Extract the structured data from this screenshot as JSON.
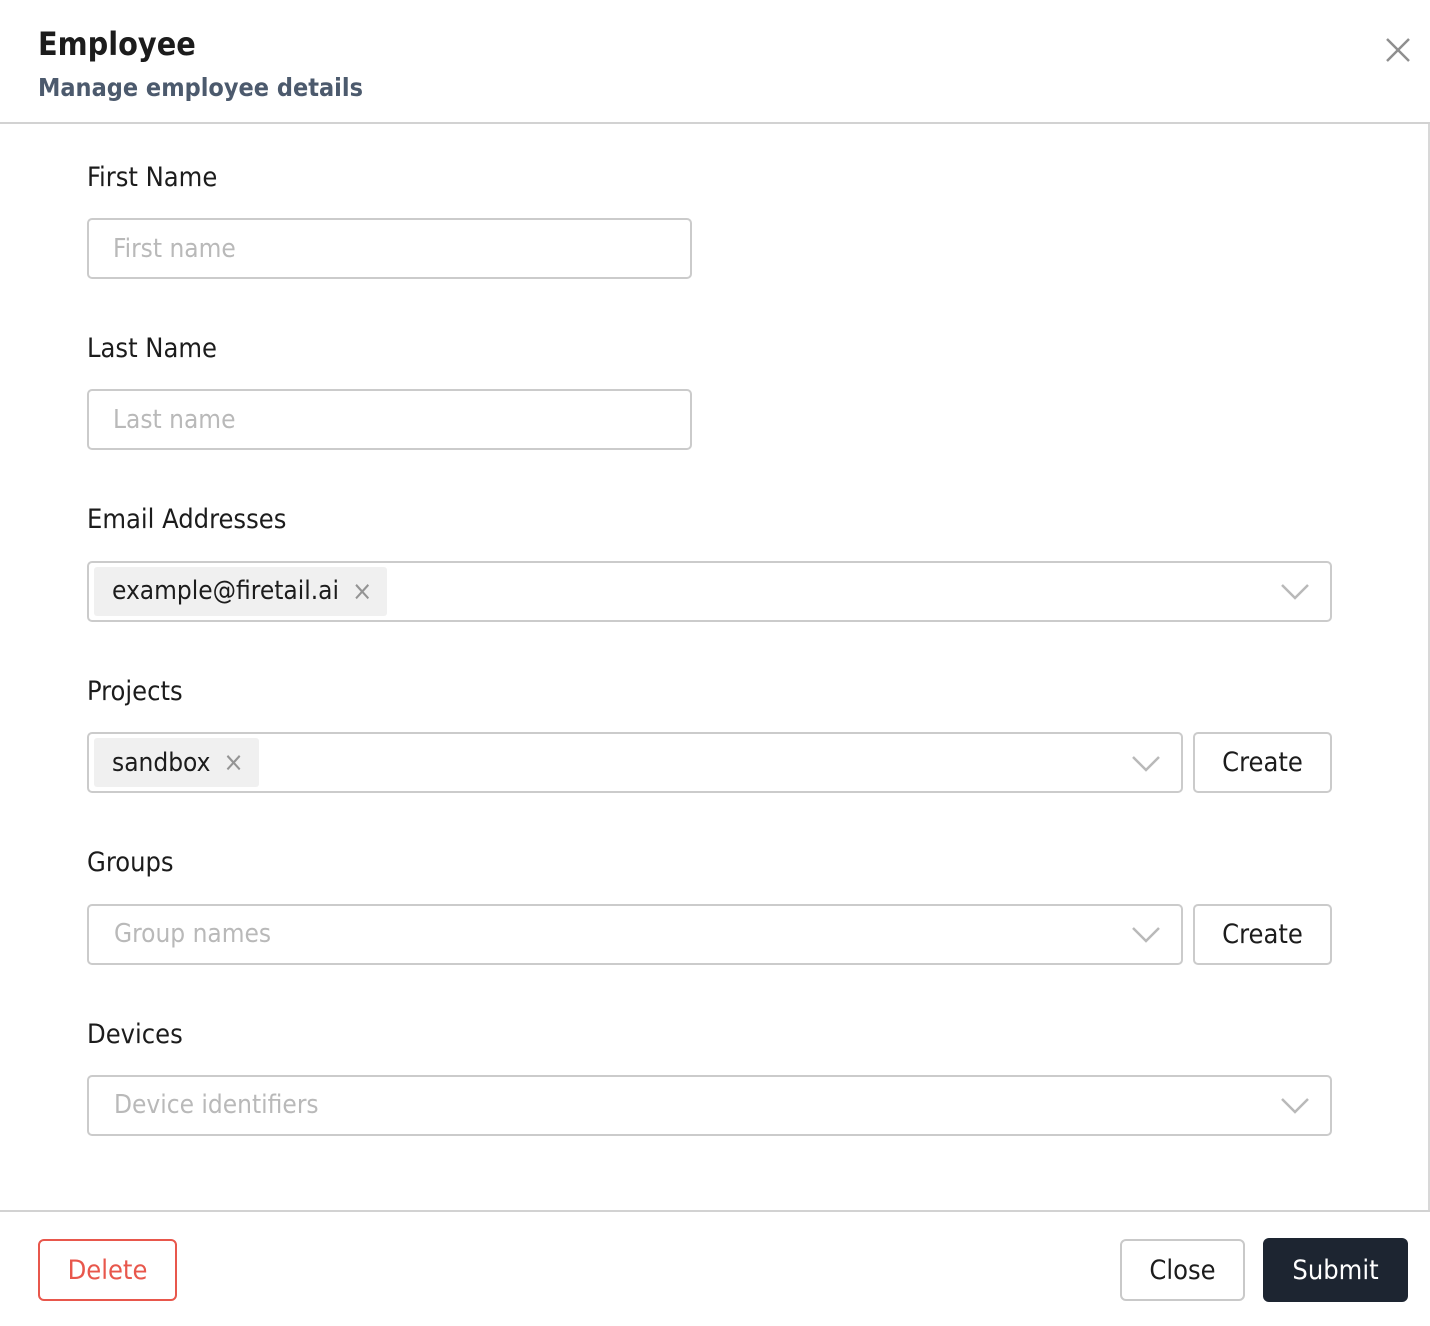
{
  "modal": {
    "title": "Employee",
    "subtitle": "Manage employee details"
  },
  "fields": {
    "first_name": {
      "label": "First Name",
      "placeholder": "First name",
      "value": ""
    },
    "last_name": {
      "label": "Last Name",
      "placeholder": "Last name",
      "value": ""
    },
    "emails": {
      "label": "Email Addresses",
      "tags": [
        "example@firetail.ai"
      ],
      "remove_glyph": "×"
    },
    "projects": {
      "label": "Projects",
      "tags": [
        "sandbox"
      ],
      "remove_glyph": "×",
      "create_label": "Create"
    },
    "groups": {
      "label": "Groups",
      "placeholder": "Group names",
      "value": "",
      "create_label": "Create"
    },
    "devices": {
      "label": "Devices",
      "placeholder": "Device identifiers",
      "value": ""
    }
  },
  "footer": {
    "delete_label": "Delete",
    "close_label": "Close",
    "submit_label": "Submit"
  },
  "colors": {
    "accent-red": "#e8574c",
    "submit-bg": "#1d2531",
    "subtitle": "#4c5a6d",
    "tag-bg": "#f0f0f0",
    "border": "#cbcbcb"
  }
}
